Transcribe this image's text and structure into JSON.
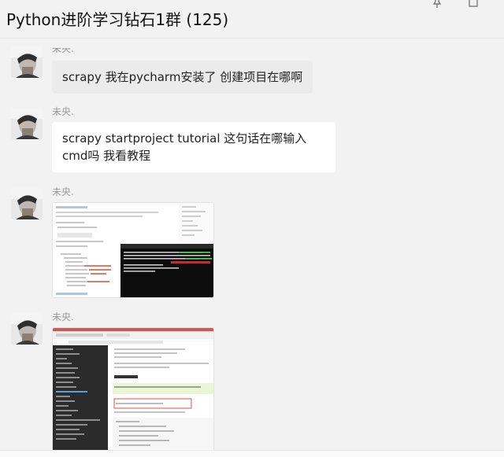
{
  "window": {
    "title": "Python进阶学习钻石1群 (125)",
    "pin_icon": "pin-icon",
    "close_icon": "close-icon"
  },
  "messages": [
    {
      "sender": "未央.",
      "text": "scrapy 我在pycharm安装了 创建项目在哪啊"
    },
    {
      "sender": "未央.",
      "text_line1": "scrapy startproject tutorial 这句话在哪输入",
      "text_line2": "cmd吗 我看教程"
    },
    {
      "sender": "未央.",
      "image": "screenshot of scrapy tutorial with cmd window"
    },
    {
      "sender": "未央.",
      "image": "screenshot of scrapy documentation webpage"
    }
  ],
  "colors": {
    "background": "#f2f2f2",
    "bubble": "#ffffff",
    "bubble_first": "#ebebeb",
    "sender_name": "#9a9a9a",
    "cmd_bg": "#0c0c0c",
    "cmd_text": "#c8c8c8",
    "doc_sidebar": "#2b2b2b",
    "doc_highlight": "#e9f5d5",
    "doc_red": "#d9534f"
  }
}
